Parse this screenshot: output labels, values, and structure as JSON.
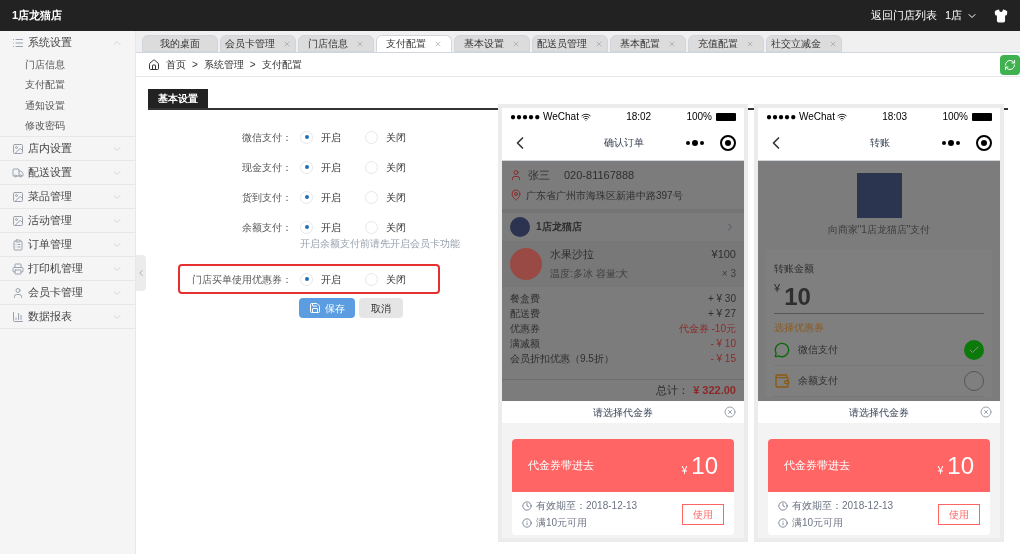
{
  "header": {
    "title": "1店龙猫店",
    "back_link": "返回门店列表",
    "store": "1店"
  },
  "sidebar": {
    "groups": [
      {
        "label": "系统设置",
        "expanded": true,
        "children": [
          {
            "label": "门店信息",
            "selected": false
          },
          {
            "label": "支付配置",
            "selected": false
          },
          {
            "label": "通知设置",
            "selected": false
          },
          {
            "label": "修改密码",
            "selected": false
          }
        ]
      },
      {
        "label": "店内设置",
        "expanded": false
      },
      {
        "label": "配送设置",
        "expanded": false
      },
      {
        "label": "菜品管理",
        "expanded": false
      },
      {
        "label": "活动管理",
        "expanded": false
      },
      {
        "label": "订单管理",
        "expanded": false
      },
      {
        "label": "打印机管理",
        "expanded": false
      },
      {
        "label": "会员卡管理",
        "expanded": false
      },
      {
        "label": "数据报表",
        "expanded": false
      }
    ]
  },
  "tabs": [
    {
      "label": "我的桌面",
      "selected": false,
      "closable": false
    },
    {
      "label": "会员卡管理",
      "selected": false,
      "closable": true
    },
    {
      "label": "门店信息",
      "selected": false,
      "closable": true
    },
    {
      "label": "支付配置",
      "selected": true,
      "closable": true
    },
    {
      "label": "基本设置",
      "selected": false,
      "closable": true
    },
    {
      "label": "配送员管理",
      "selected": false,
      "closable": true
    },
    {
      "label": "基本配置",
      "selected": false,
      "closable": true
    },
    {
      "label": "充值配置",
      "selected": false,
      "closable": true
    },
    {
      "label": "社交立减金",
      "selected": false,
      "closable": true
    }
  ],
  "breadcrumb": [
    "首页",
    "系统管理",
    "支付配置"
  ],
  "breadcrumb_separator": ">",
  "section_title": "基本设置",
  "form": {
    "rows": [
      {
        "label": "微信支付：",
        "highlighted": false,
        "options": [
          {
            "label": "开启",
            "selected": true
          },
          {
            "label": "关闭",
            "selected": false
          }
        ]
      },
      {
        "label": "现金支付：",
        "highlighted": false,
        "options": [
          {
            "label": "开启",
            "selected": true
          },
          {
            "label": "关闭",
            "selected": false
          }
        ]
      },
      {
        "label": "货到支付：",
        "highlighted": false,
        "options": [
          {
            "label": "开启",
            "selected": true
          },
          {
            "label": "关闭",
            "selected": false
          }
        ]
      },
      {
        "label": "余额支付：",
        "highlighted": false,
        "hint": "开启余额支付前请先开启会员卡功能",
        "options": [
          {
            "label": "开启",
            "selected": true
          },
          {
            "label": "关闭",
            "selected": false
          }
        ]
      },
      {
        "label": "门店买单使用优惠券：",
        "highlighted": true,
        "options": [
          {
            "label": "开启",
            "selected": true
          },
          {
            "label": "关闭",
            "selected": false
          }
        ]
      }
    ],
    "buttons": [
      {
        "label": "保存",
        "kind": "primary"
      },
      {
        "label": "取消",
        "kind": "default"
      }
    ]
  },
  "phones": [
    {
      "kind": "order",
      "carrier": "●●●●● WeChat",
      "time": "18:02",
      "battery": "100%",
      "nav_title": "确认订单",
      "contact_name": "张三",
      "contact_phone": "020-81167888",
      "address": "广东省广州市海珠区新港中路397号",
      "shop": "1店龙猫店",
      "item": {
        "name": "水果沙拉",
        "spec": "温度:多冰 容量:大",
        "price": "¥100",
        "qty": "× 3"
      },
      "fees": [
        {
          "label": "餐盒费",
          "value": "+ ¥ 30",
          "discount": false
        },
        {
          "label": "配送费",
          "value": "+ ¥ 27",
          "discount": false
        },
        {
          "label": "优惠券",
          "value": "代金券 -10元",
          "discount": true
        },
        {
          "label": "满减额",
          "value": "- ¥ 10",
          "discount": true
        },
        {
          "label": "会员折扣优惠（9.5折）",
          "value": "- ¥ 15",
          "discount": true
        }
      ],
      "total_label": "总计：",
      "total": "¥ 322.00",
      "sheet": {
        "title": "请选择代金券",
        "coupon_name": "代金券带进去",
        "currency": "¥",
        "amount": "10",
        "validity": "有效期至：2018-12-13",
        "condition": "满10元可用",
        "use": "使用"
      }
    },
    {
      "kind": "transfer",
      "carrier": "●●●●● WeChat",
      "time": "18:03",
      "battery": "100%",
      "nav_title": "转账",
      "payee": "向商家\"1店龙猫店\"支付",
      "amount_label": "转账金额",
      "currency": "¥",
      "amount": "10",
      "coupon_link": "选择优惠券",
      "methods": [
        {
          "label": "微信支付",
          "selected": true
        },
        {
          "label": "余额支付",
          "selected": false
        }
      ],
      "sheet": {
        "title": "请选择代金券",
        "coupon_name": "代金券带进去",
        "currency": "¥",
        "amount": "10",
        "validity": "有效期至：2018-12-13",
        "condition": "满10元可用",
        "use": "使用"
      }
    }
  ]
}
